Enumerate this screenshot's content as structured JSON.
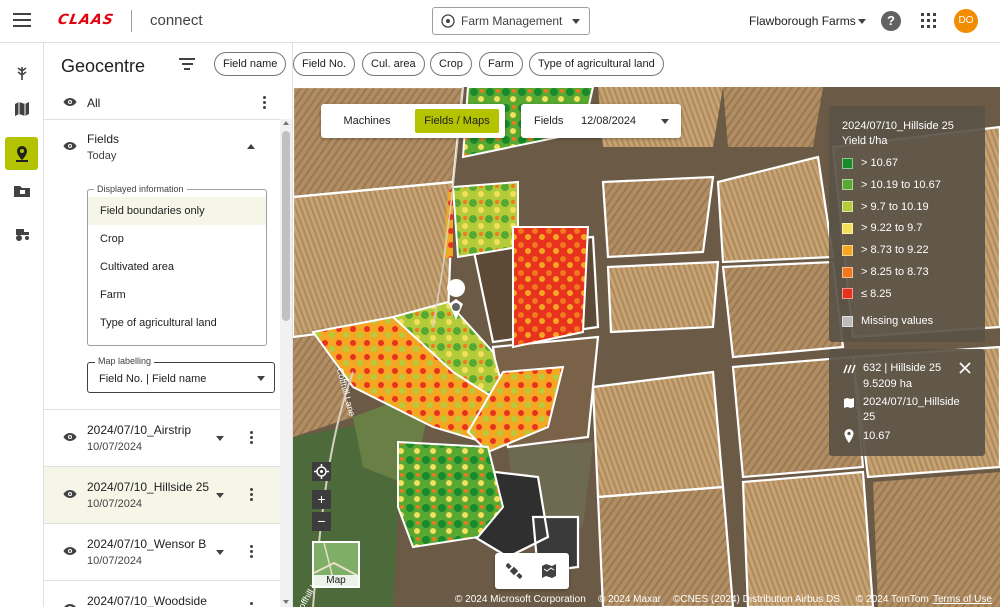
{
  "header": {
    "brand": "CLAAS",
    "app_name": "connect",
    "context_select": "Farm Management",
    "organization": "Flawborough Farms",
    "help": "?",
    "avatar_initials": "DO"
  },
  "rail": {
    "items": [
      {
        "icon": "crop-icon",
        "active": false
      },
      {
        "icon": "map-icon",
        "active": false
      },
      {
        "icon": "location-pin-icon",
        "active": true
      },
      {
        "icon": "folder-icon",
        "active": false
      },
      {
        "icon": "machinery-icon",
        "active": false
      }
    ]
  },
  "panel": {
    "title": "Geocentre",
    "all_label": "All",
    "fields": {
      "label": "Fields",
      "sub": "Today"
    },
    "displayed_info": {
      "legend": "Displayed information",
      "options": [
        "Field boundaries only",
        "Crop",
        "Cultivated area",
        "Farm",
        "Type of agricultural land"
      ]
    },
    "map_labelling": {
      "legend": "Map labelling",
      "value": "Field No. | Field name"
    },
    "layers": [
      {
        "name": "2024/07/10_Airstrip",
        "date": "10/07/2024"
      },
      {
        "name": "2024/07/10_Hillside 25",
        "date": "10/07/2024"
      },
      {
        "name": "2024/07/10_Wensor B",
        "date": "10/07/2024"
      },
      {
        "name": "2024/07/10_Woodside",
        "date": ""
      }
    ]
  },
  "filters": {
    "chips": [
      "Field name",
      "Field No.",
      "Cul. area",
      "Crop",
      "Farm",
      "Type of agricultural land"
    ]
  },
  "map": {
    "mode_tabs": [
      "Machines",
      "Fields / Maps"
    ],
    "active_mode": "Fields / Maps",
    "fields_label": "Fields",
    "fields_date": "12/08/2024",
    "legend": {
      "title_line1": "2024/07/10_Hillside 25",
      "title_line2": "Yield t/ha",
      "items": [
        {
          "label": "> 10.67",
          "color": "#1a8a2a"
        },
        {
          "label": "> 10.19 to 10.67",
          "color": "#58a832"
        },
        {
          "label": "> 9.7 to 10.19",
          "color": "#b4cc3c"
        },
        {
          "label": "> 9.22 to 9.7",
          "color": "#f3df5a"
        },
        {
          "label": "> 8.73 to 9.22",
          "color": "#f5a623"
        },
        {
          "label": "> 8.25 to 8.73",
          "color": "#f0781e"
        },
        {
          "label": "≤ 8.25",
          "color": "#e8321e"
        },
        {
          "label": "Missing values",
          "color": "#bdbdbd"
        }
      ]
    },
    "info": {
      "field": "632 | Hillside 25",
      "area": "9.5209 ha",
      "layer_line1": "2024/07/10_Hillside",
      "layer_line2": "25",
      "value": "10.67"
    },
    "controls": {
      "zoom_in": "+",
      "zoom_out": "−",
      "minimap_label": "Map"
    },
    "road_labels": [
      "Coffhill Lane",
      "Coffhill Lane"
    ],
    "attribution": [
      "© 2024 Microsoft Corporation",
      "© 2024 Maxar",
      "©CNES (2024) Distribution Airbus DS",
      "© 2024 TomTom",
      "Terms of Use"
    ]
  }
}
